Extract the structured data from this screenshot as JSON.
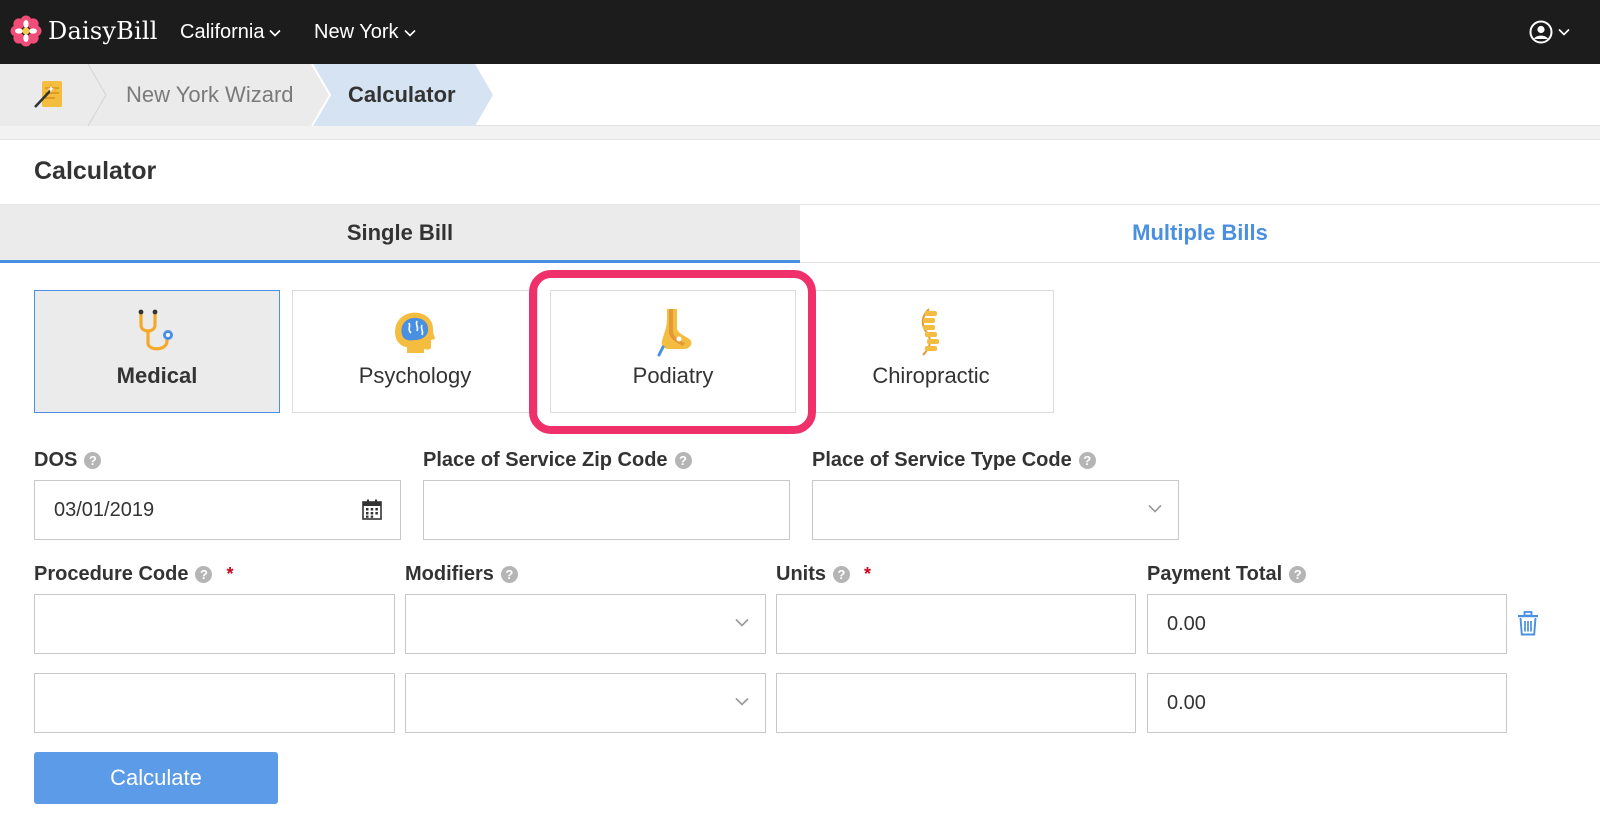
{
  "header": {
    "brand": "DaisyBill",
    "nav": [
      {
        "label": "California"
      },
      {
        "label": "New York"
      }
    ],
    "colors": {
      "bar": "#1c1c1c",
      "accent": "#4a90e2"
    }
  },
  "breadcrumb": {
    "home_icon": "wizard-wand-icon",
    "items": [
      "New York Wizard",
      "Calculator"
    ]
  },
  "page": {
    "title": "Calculator"
  },
  "tabs": [
    {
      "label": "Single Bill",
      "active": true
    },
    {
      "label": "Multiple Bills",
      "active": false
    }
  ],
  "specialties": [
    {
      "label": "Medical",
      "icon": "stethoscope-icon",
      "selected": true
    },
    {
      "label": "Psychology",
      "icon": "brain-icon",
      "selected": false
    },
    {
      "label": "Podiatry",
      "icon": "foot-icon",
      "selected": false,
      "highlighted": true
    },
    {
      "label": "Chiropractic",
      "icon": "spine-icon",
      "selected": false
    }
  ],
  "form": {
    "dos": {
      "label": "DOS",
      "value": "03/01/2019"
    },
    "zip": {
      "label": "Place of Service Zip Code",
      "value": ""
    },
    "type_code": {
      "label": "Place of Service Type Code",
      "value": ""
    },
    "columns": {
      "procedure": "Procedure Code",
      "modifiers": "Modifiers",
      "units": "Units",
      "payment": "Payment Total"
    },
    "rows": [
      {
        "procedure": "",
        "modifiers": "",
        "units": "",
        "payment": "0.00"
      },
      {
        "procedure": "",
        "modifiers": "",
        "units": "",
        "payment": "0.00"
      }
    ],
    "required_marker": "*",
    "help_glyph": "?"
  },
  "actions": {
    "calculate": "Calculate"
  }
}
